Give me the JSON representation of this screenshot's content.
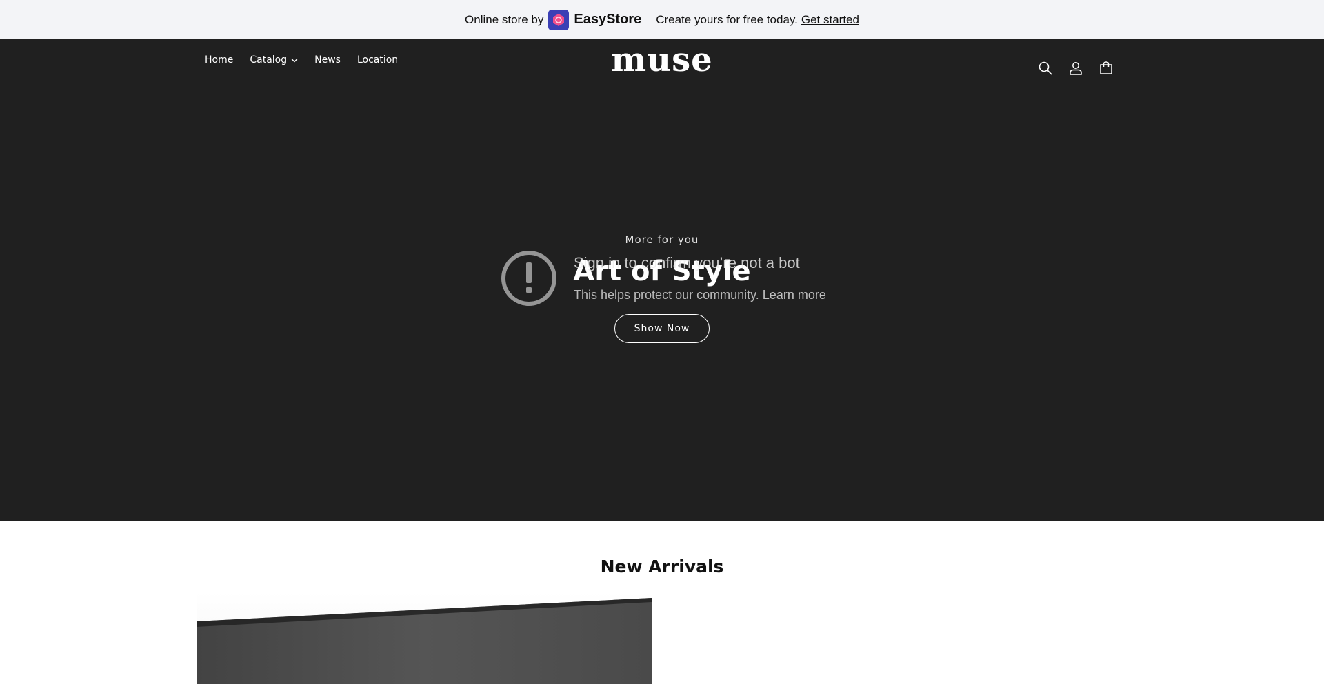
{
  "promo_bar": {
    "prefix": "Online store by",
    "brand_name": "EasyStore",
    "cta_text": "Create yours for free today.",
    "cta_link": "Get started",
    "brand_color": "#3b3fb5"
  },
  "header": {
    "nav": {
      "home": "Home",
      "catalog": "Catalog",
      "news": "News",
      "location": "Location"
    },
    "logo": "muse",
    "icons": [
      "search-icon",
      "account-icon",
      "cart-icon"
    ]
  },
  "hero": {
    "eyebrow": "More for you",
    "title": "Art of Style",
    "button_label": "Show Now",
    "background_color": "#202020"
  },
  "bot_check": {
    "title": "Sign in to confirm you’re not a bot",
    "description": "This helps protect our community.",
    "learn_more": "Learn more"
  },
  "new_arrivals": {
    "title": "New Arrivals"
  }
}
